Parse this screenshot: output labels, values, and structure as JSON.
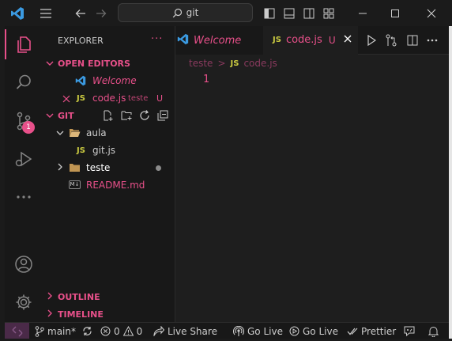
{
  "titlebar": {
    "search_text": "git"
  },
  "activity": {
    "source_control_badge": "1"
  },
  "sidebar": {
    "title": "EXPLORER",
    "more": "···",
    "open_editors": {
      "header": "OPEN EDITORS",
      "items": [
        {
          "name": "Welcome"
        },
        {
          "icon_label": "JS",
          "name": "code.js",
          "folder": "teste",
          "status": "U"
        }
      ]
    },
    "workspace": {
      "header": "GIT",
      "items": [
        {
          "name": "aula"
        },
        {
          "icon_label": "JS",
          "name": "git.js"
        },
        {
          "name": "teste"
        },
        {
          "icon_label": "M↓",
          "name": "README.md"
        }
      ]
    },
    "outline": "OUTLINE",
    "timeline": "TIMELINE"
  },
  "editor": {
    "tabs": [
      {
        "label": "Welcome"
      },
      {
        "icon_label": "JS",
        "label": "code.js",
        "status": "U"
      }
    ],
    "breadcrumb": {
      "folder": "teste",
      "sep": ">",
      "icon_label": "JS",
      "file": "code.js"
    },
    "line_number": "1"
  },
  "statusbar": {
    "branch": "main*",
    "errors": "0",
    "warnings": "0",
    "live_share": "Live Share",
    "go_live_1": "Go Live",
    "go_live_2": "Go Live",
    "prettier": "Prettier"
  },
  "colors": {
    "accent": "#e8508a",
    "vscode_blue": "#3b9ae1",
    "js_yellow": "#cbcb41",
    "folder": "#c09553"
  }
}
